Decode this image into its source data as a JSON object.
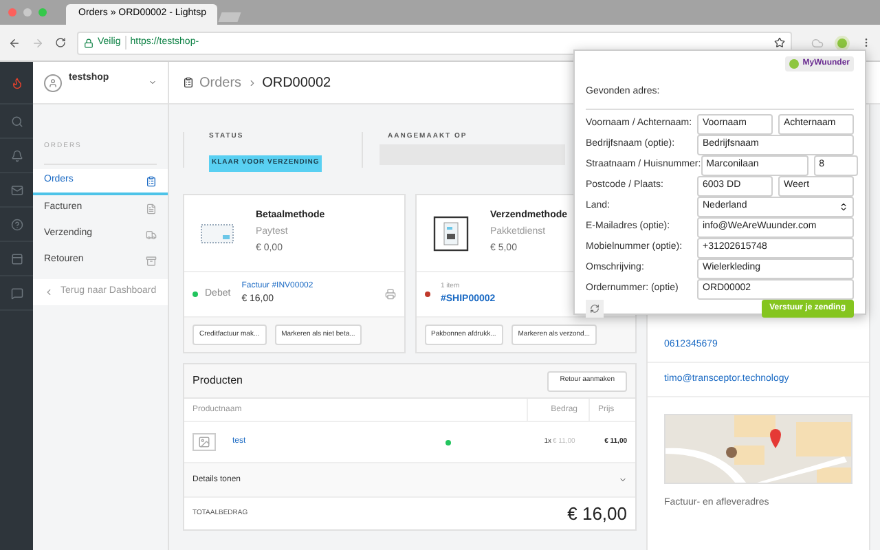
{
  "browser": {
    "tab_title": "Orders » ORD00002 - Lightsp",
    "secure_label": "Veilig",
    "url": "https://testshop-"
  },
  "sidebar": {
    "shop": "testshop",
    "section": "ORDERS",
    "items": [
      {
        "label": "Orders",
        "selected": true
      },
      {
        "label": "Facturen",
        "selected": false
      },
      {
        "label": "Verzending",
        "selected": false
      },
      {
        "label": "Retouren",
        "selected": false
      }
    ],
    "back": "Terug naar Dashboard"
  },
  "header": {
    "parent": "Orders",
    "current": "ORD00002"
  },
  "status": {
    "label": "STATUS",
    "badge": "KLAAR VOOR VERZENDING",
    "created_label": "AANGEMAAKT OP"
  },
  "payment": {
    "title": "Betaalmethode",
    "method": "Paytest",
    "amount": "€ 0,00",
    "state": "Debet",
    "color": "#22c55e",
    "invoice": "Factuur #INV00002",
    "invoice_amount": "€ 16,00",
    "buttons": [
      "Creditfactuur mak...",
      "Markeren als niet beta..."
    ]
  },
  "shipping": {
    "title": "Verzendmethode",
    "method": "Pakketdienst",
    "amount": "€ 5,00",
    "count": "1 item",
    "shipment": "#SHIP00002",
    "color": "#c0392b",
    "buttons": [
      "Pakbonnen afdrukk...",
      "Markeren als verzond..."
    ]
  },
  "products": {
    "title": "Producten",
    "return_button": "Retour aanmaken",
    "columns": [
      "Productnaam",
      "Bedrag",
      "Prijs"
    ],
    "rows": [
      {
        "name": "test",
        "quantity": "1x",
        "unit_price": "€ 11,00",
        "price": "€ 11,00",
        "color": "#22c55e"
      }
    ],
    "details": "Details tonen",
    "total_label": "TOTAALBEDRAG",
    "total": "€ 16,00"
  },
  "customer": {
    "phone": "0612345679",
    "email": "timo@transceptor.technology",
    "address_label": "Factuur- en afleveradres"
  },
  "popup": {
    "brand": "MyWuunder",
    "heading": "Gevonden adres:",
    "fields": [
      {
        "label": "Voornaam / Achternaam:",
        "kind": "pair",
        "values": [
          "Voornaam",
          "Achternaam"
        ]
      },
      {
        "label": "Bedrijfsnaam (optie):",
        "kind": "text",
        "values": [
          "Bedrijfsnaam"
        ]
      },
      {
        "label": "Straatnaam / Huisnummer:",
        "kind": "street",
        "values": [
          "Marconilaan",
          "8"
        ]
      },
      {
        "label": "Postcode / Plaats:",
        "kind": "pair",
        "values": [
          "6003 DD",
          "Weert"
        ]
      },
      {
        "label": "Land:",
        "kind": "select",
        "values": [
          "Nederland"
        ]
      },
      {
        "label": "E-Mailadres (optie):",
        "kind": "text",
        "values": [
          "info@WeAreWuunder.com"
        ]
      },
      {
        "label": "Mobielnummer (optie):",
        "kind": "text",
        "values": [
          "+31202615748"
        ]
      },
      {
        "label": "Omschrijving:",
        "kind": "text",
        "values": [
          "Wielerkleding"
        ]
      },
      {
        "label": "Ordernummer: (optie)",
        "kind": "text",
        "values": [
          "ORD00002"
        ]
      }
    ],
    "submit": "Verstuur je zending"
  }
}
